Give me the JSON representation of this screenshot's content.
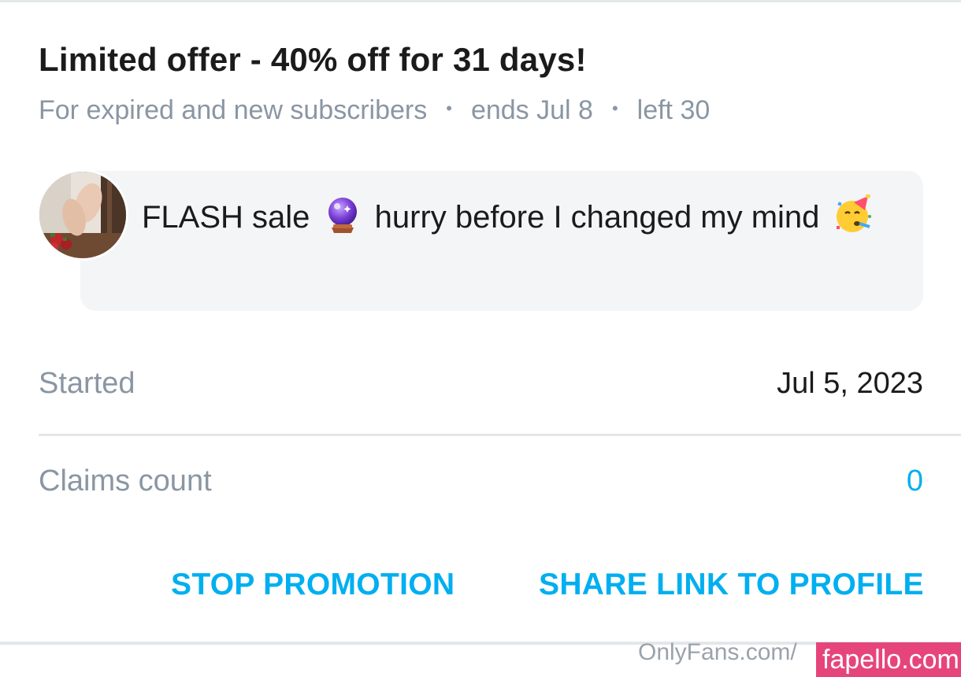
{
  "offer": {
    "title": "Limited offer - 40% off for 31 days!",
    "audience": "For expired and new subscribers",
    "separator": "•",
    "ends": "ends Jul 8",
    "left": "left 30"
  },
  "message": {
    "text_part1": "FLASH sale",
    "text_part2": "hurry before I changed my mind",
    "emojis": [
      "crystal-ball-emoji",
      "partying-face-emoji"
    ]
  },
  "details": {
    "started_label": "Started",
    "started_value": "Jul 5, 2023",
    "claims_label": "Claims count",
    "claims_value": "0"
  },
  "actions": {
    "stop_label": "STOP PROMOTION",
    "share_label": "SHARE LINK TO PROFILE"
  },
  "watermarks": {
    "onlyfans": "OnlyFans.com/",
    "fapello": "fapello.com"
  },
  "colors": {
    "accent": "#00aff0",
    "muted_text": "#8a96a3",
    "bubble_bg": "#f3f5f6",
    "divider": "#e3e7ea",
    "watermark_pink": "#e6457c"
  }
}
